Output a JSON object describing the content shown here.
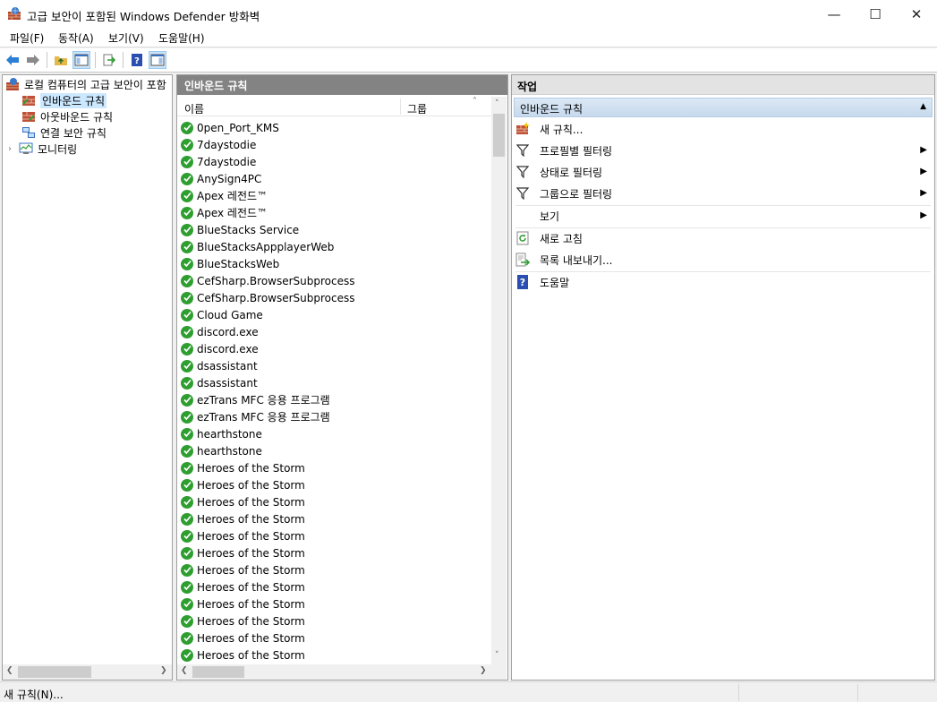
{
  "window": {
    "title": "고급 보안이 포함된 Windows Defender 방화벽",
    "minimize": "—",
    "maximize": "☐",
    "close": "✕"
  },
  "menu": [
    {
      "label": "파일(F)"
    },
    {
      "label": "동작(A)"
    },
    {
      "label": "보기(V)"
    },
    {
      "label": "도움말(H)"
    }
  ],
  "toolbar": {
    "icons": [
      "back-arrow-icon",
      "forward-arrow-icon",
      "up-folder-icon",
      "show-hide-tree-icon",
      "export-list-icon",
      "help-icon",
      "show-hide-action-pane-icon"
    ]
  },
  "tree": {
    "root": "로컬 컴퓨터의 고급 보안이 포함",
    "items": [
      {
        "label": "인바운드 규칙"
      },
      {
        "label": "아웃바운드 규칙"
      },
      {
        "label": "연결 보안 규칙"
      },
      {
        "label": "모니터링"
      }
    ]
  },
  "list": {
    "header": "인바운드 규칙",
    "columns": {
      "name": "이름",
      "group": "그룹"
    },
    "rows": [
      "0pen_Port_KMS",
      "7daystodie",
      "7daystodie",
      "AnySign4PC",
      "Apex 레전드™",
      "Apex 레전드™",
      "BlueStacks Service",
      "BlueStacksAppplayerWeb",
      "BlueStacksWeb",
      "CefSharp.BrowserSubprocess",
      "CefSharp.BrowserSubprocess",
      "Cloud Game",
      "discord.exe",
      "discord.exe",
      "dsassistant",
      "dsassistant",
      "ezTrans MFC 응용 프로그램",
      "ezTrans MFC 응용 프로그램",
      "hearthstone",
      "hearthstone",
      "Heroes of the Storm",
      "Heroes of the Storm",
      "Heroes of the Storm",
      "Heroes of the Storm",
      "Heroes of the Storm",
      "Heroes of the Storm",
      "Heroes of the Storm",
      "Heroes of the Storm",
      "Heroes of the Storm",
      "Heroes of the Storm",
      "Heroes of the Storm",
      "Heroes of the Storm"
    ]
  },
  "actions": {
    "header": "작업",
    "section": "인바운드 규칙",
    "items": [
      {
        "label": "새 규칙...",
        "icon": "new-rule-icon"
      },
      {
        "label": "프로필별 필터링",
        "icon": "filter-icon"
      },
      {
        "label": "상태로 필터링",
        "icon": "filter-icon"
      },
      {
        "label": "그룹으로 필터링",
        "icon": "filter-icon"
      },
      {
        "label": "보기",
        "icon": ""
      },
      {
        "label": "새로 고침",
        "icon": "refresh-icon"
      },
      {
        "label": "목록 내보내기...",
        "icon": "export-list-icon"
      },
      {
        "label": "도움말",
        "icon": "help-icon"
      }
    ]
  },
  "status": {
    "text": "새 규칙(N)..."
  }
}
